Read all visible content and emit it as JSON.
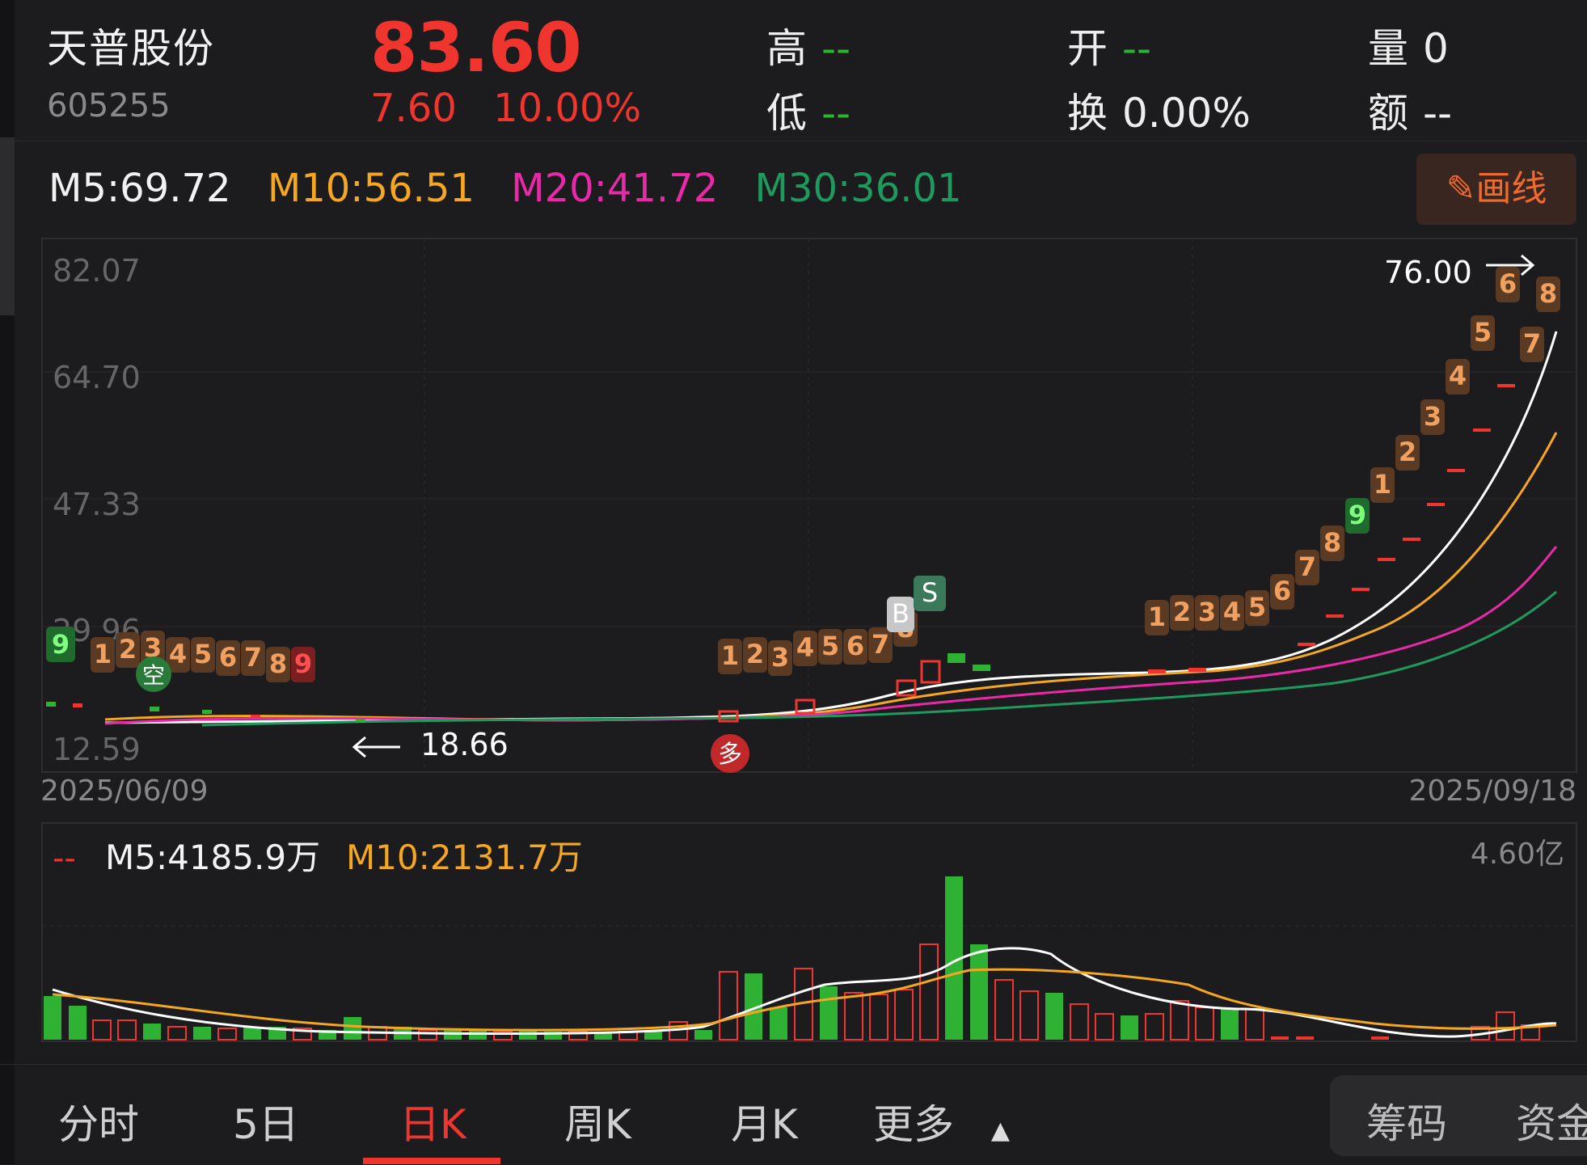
{
  "stock": {
    "name": "天普股份",
    "code": "605255",
    "price": "83.60",
    "change": "7.60",
    "change_pct": "10.00%"
  },
  "stats": {
    "high_label": "高",
    "high_value": "--",
    "low_label": "低",
    "low_value": "--",
    "open_label": "开",
    "open_value": "--",
    "turnover_label": "换",
    "turnover_value": "0.00%",
    "volume_label": "量",
    "volume_value": "0",
    "amount_label": "额",
    "amount_value": "--"
  },
  "ma": {
    "m5": "M5:69.72",
    "m10": "M10:56.51",
    "m20": "M20:41.72",
    "m30": "M30:36.01"
  },
  "draw_button": "画线",
  "price_axis": [
    "82.07",
    "64.70",
    "47.33",
    "29.96",
    "12.59"
  ],
  "date_start": "2025/06/09",
  "date_end": "2025/09/18",
  "annotations": {
    "low_price": "18.66",
    "high_price": "76.00",
    "buy": "B",
    "sell": "S",
    "duo": "多",
    "kong": "空"
  },
  "volume": {
    "indicator": "--",
    "m5": "M5:4185.9万",
    "m10": "M10:2131.7万",
    "max": "4.60亿"
  },
  "tabs": [
    "分时",
    "5日",
    "日K",
    "周K",
    "月K",
    "更多"
  ],
  "active_tab": "日K",
  "right_tabs": [
    "筹码",
    "资金"
  ],
  "colors": {
    "up": "#f0352f",
    "down": "#2fb233",
    "ma5": "#ffffff",
    "ma10": "#f5a623",
    "ma20": "#e82aa8",
    "ma30": "#1f9a5e"
  }
}
